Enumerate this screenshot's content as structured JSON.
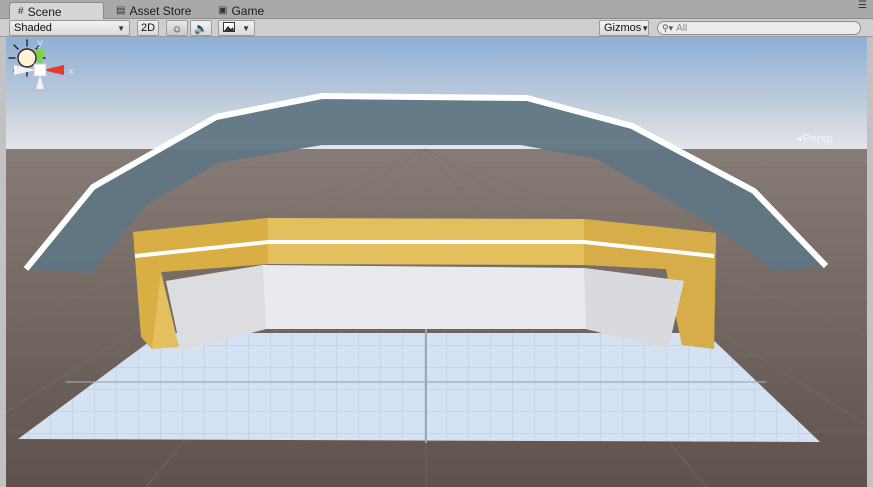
{
  "tabs": [
    {
      "label": "Scene",
      "icon": "grid-icon",
      "active": true
    },
    {
      "label": "Asset Store",
      "icon": "store-icon",
      "active": false
    },
    {
      "label": "Game",
      "icon": "game-icon",
      "active": false
    }
  ],
  "toolbar": {
    "shading_mode": "Shaded",
    "mode_2d": "2D",
    "lighting_icon": "sun-icon",
    "audio_icon": "speaker-icon",
    "effects_icon": "image-icon",
    "gizmos_label": "Gizmos",
    "search_placeholder": "All"
  },
  "scene_gizmo": {
    "y_label": "y",
    "x_label": "x",
    "projection_label": "Persp"
  },
  "colors": {
    "sky_top": "#8fb0d8",
    "horizon": "#dfe3e8",
    "ground": "#6b5e57",
    "floor": "#d6e2f2",
    "ramp": "#5d7481",
    "wall_gold": "#e6c260",
    "wall_white": "#e8e9ec",
    "axis_x": "#e23b2e",
    "axis_y": "#7dd242"
  }
}
